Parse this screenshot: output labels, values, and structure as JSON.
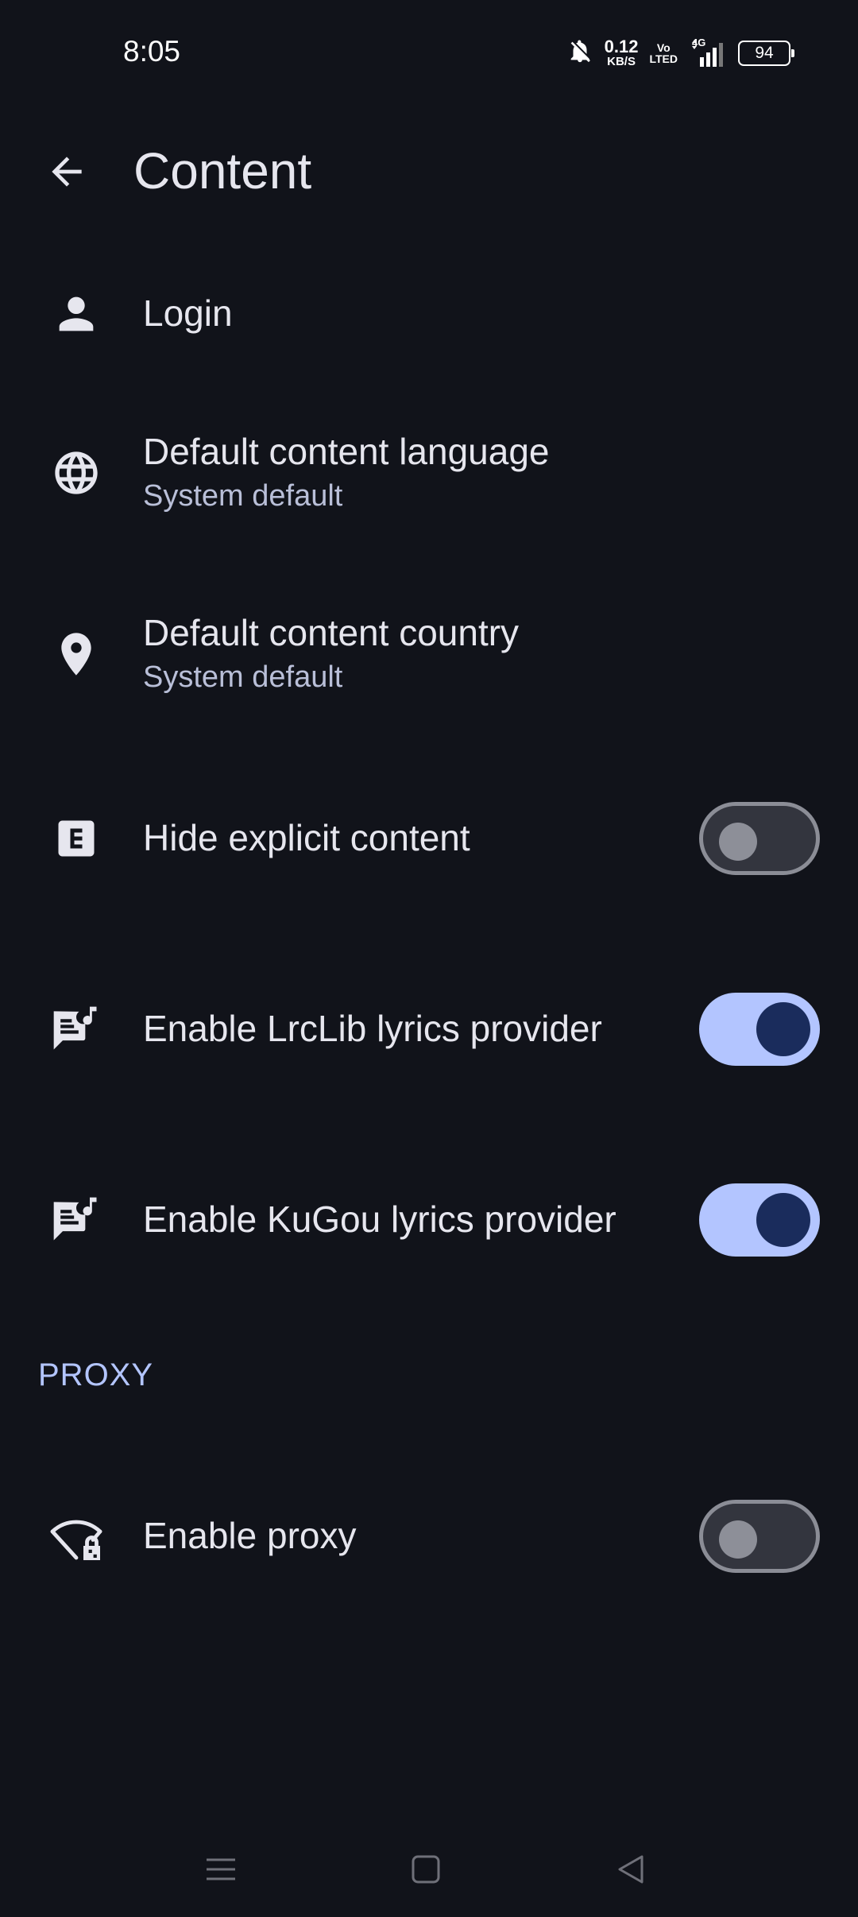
{
  "status_bar": {
    "time": "8:05",
    "net_speed_value": "0.12",
    "net_speed_unit": "KB/S",
    "volte_top": "Vo",
    "volte_bottom": "LTED",
    "network_type": "4G",
    "battery": "94",
    "icons": [
      "bell-off-icon",
      "signal-icon",
      "battery-icon"
    ]
  },
  "app_bar": {
    "title": "Content",
    "back_icon": "arrow-left-icon"
  },
  "settings": [
    {
      "title": "Login",
      "icon": "person-icon"
    },
    {
      "title": "Default content language",
      "subtitle": "System default",
      "icon": "globe-icon"
    },
    {
      "title": "Default content country",
      "subtitle": "System default",
      "icon": "location-pin-icon"
    },
    {
      "title": "Hide explicit content",
      "icon": "explicit-icon",
      "switch_on": false
    },
    {
      "title": "Enable LrcLib lyrics provider",
      "icon": "lyrics-icon",
      "switch_on": true
    },
    {
      "title": "Enable KuGou lyrics provider",
      "icon": "lyrics-icon",
      "switch_on": true
    }
  ],
  "proxy_section": {
    "header": "PROXY",
    "items": [
      {
        "title": "Enable proxy",
        "icon": "wifi-lock-icon",
        "switch_on": false
      }
    ]
  },
  "colors": {
    "background": "#11131a",
    "accent": "#b3c5ff",
    "switch_thumb_on": "#1a2c5c"
  },
  "nav_bar": {
    "icons": [
      "menu-icon",
      "home-icon",
      "back-icon"
    ]
  }
}
